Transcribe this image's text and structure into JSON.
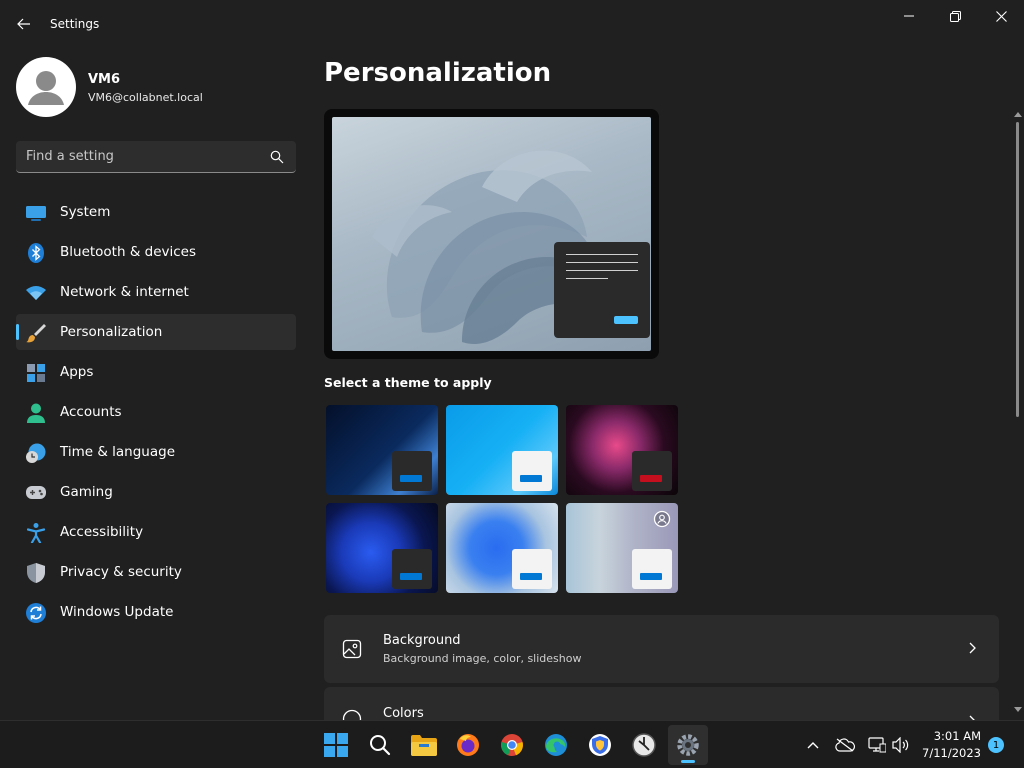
{
  "window": {
    "title": "Settings"
  },
  "profile": {
    "name": "VM6",
    "email": "VM6@collabnet.local"
  },
  "search": {
    "placeholder": "Find a setting"
  },
  "sidebar": {
    "items": [
      {
        "label": "System",
        "icon": "monitor-icon"
      },
      {
        "label": "Bluetooth & devices",
        "icon": "bluetooth-icon"
      },
      {
        "label": "Network & internet",
        "icon": "wifi-icon"
      },
      {
        "label": "Personalization",
        "icon": "brush-icon",
        "active": true
      },
      {
        "label": "Apps",
        "icon": "apps-icon"
      },
      {
        "label": "Accounts",
        "icon": "person-icon"
      },
      {
        "label": "Time & language",
        "icon": "globe-clock-icon"
      },
      {
        "label": "Gaming",
        "icon": "gamepad-icon"
      },
      {
        "label": "Accessibility",
        "icon": "accessibility-icon"
      },
      {
        "label": "Privacy & security",
        "icon": "shield-icon"
      },
      {
        "label": "Windows Update",
        "icon": "update-icon"
      }
    ]
  },
  "main": {
    "title": "Personalization",
    "themes_heading": "Select a theme to apply",
    "themes": [
      {
        "id": "windows-dark",
        "accent": "#0078d4"
      },
      {
        "id": "windows-light",
        "accent": "#0078d4"
      },
      {
        "id": "glow",
        "accent": "#c50f1f"
      },
      {
        "id": "windows-11-dark",
        "accent": "#0078d4"
      },
      {
        "id": "windows-11-light",
        "accent": "#0078d4"
      },
      {
        "id": "flowers",
        "accent": "#0078d4"
      }
    ],
    "cards": [
      {
        "title": "Background",
        "subtitle": "Background image, color, slideshow",
        "icon": "image-icon"
      },
      {
        "title": "Colors",
        "subtitle": "",
        "icon": "palette-icon"
      }
    ]
  },
  "taskbar": {
    "apps": [
      "start-icon",
      "search-icon",
      "file-explorer-icon",
      "firefox-icon",
      "chrome-icon",
      "edge-icon",
      "brave-icon",
      "clock-app-icon",
      "settings-icon"
    ],
    "clock": {
      "time": "3:01 AM",
      "date": "7/11/2023"
    },
    "notification_count": "1"
  },
  "colors": {
    "accent": "#4cc2ff",
    "background": "#202020",
    "card": "#2b2b2b"
  }
}
